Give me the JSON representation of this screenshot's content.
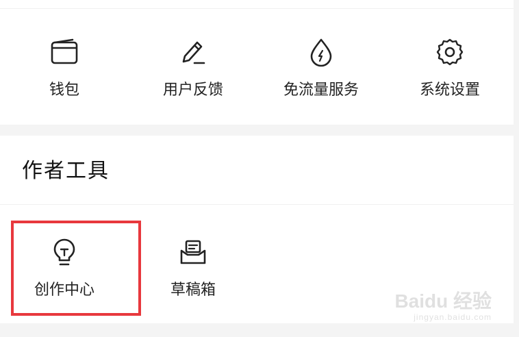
{
  "services": {
    "items": [
      {
        "label": "钱包",
        "icon": "wallet-icon"
      },
      {
        "label": "用户反馈",
        "icon": "feedback-pencil-icon"
      },
      {
        "label": "免流量服务",
        "icon": "data-drop-icon"
      },
      {
        "label": "系统设置",
        "icon": "gear-icon"
      }
    ]
  },
  "author_tools": {
    "title": "作者工具",
    "items": [
      {
        "label": "创作中心",
        "icon": "lightbulb-icon"
      },
      {
        "label": "草稿箱",
        "icon": "draft-box-icon"
      }
    ]
  },
  "highlight_color": "#e8383d",
  "watermark": {
    "logo": "Baidu 经验",
    "url": "jingyan.baidu.com"
  }
}
